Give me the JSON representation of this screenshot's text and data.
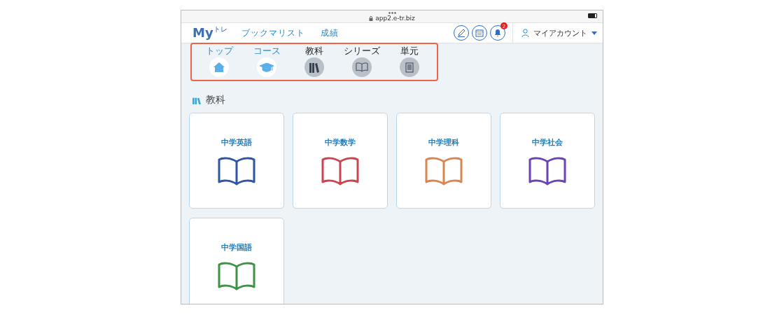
{
  "browser": {
    "url": "app2.e-tr.biz"
  },
  "header": {
    "logo": {
      "main": "My",
      "sub": "トレ"
    },
    "nav": [
      "ブックマリスト",
      "成績"
    ],
    "notification_count": "2",
    "account": "マイアカウント"
  },
  "breadcrumb": [
    {
      "label": "トップ",
      "kind": "home",
      "visited": true
    },
    {
      "label": "コース",
      "kind": "course",
      "visited": true
    },
    {
      "label": "教科",
      "kind": "books",
      "visited": false
    },
    {
      "label": "シリーズ",
      "kind": "book",
      "visited": false
    },
    {
      "label": "単元",
      "kind": "document",
      "visited": false
    }
  ],
  "section_title": "教科",
  "subjects": [
    {
      "name": "中学英語",
      "color": "#2f55a8"
    },
    {
      "name": "中学数学",
      "color": "#cc4452"
    },
    {
      "name": "中学理科",
      "color": "#d98650"
    },
    {
      "name": "中学社会",
      "color": "#6a44b4"
    },
    {
      "name": "中学国語",
      "color": "#3d9444"
    }
  ]
}
